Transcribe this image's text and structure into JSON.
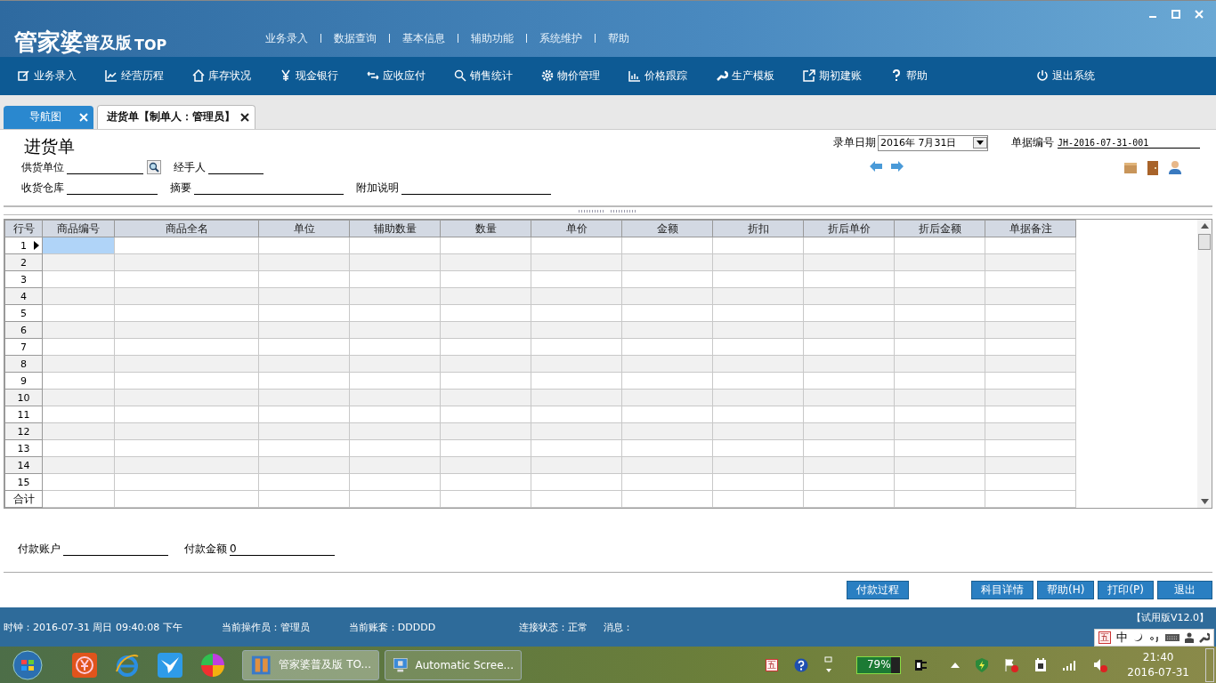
{
  "logo": {
    "name": "管家婆",
    "edition": "普及版",
    "suffix": "TOP"
  },
  "menu": [
    "业务录入",
    "数据查询",
    "基本信息",
    "辅助功能",
    "系统维护",
    "帮助"
  ],
  "toolbar": [
    {
      "label": "业务录入",
      "kind": "entry"
    },
    {
      "label": "经营历程",
      "kind": "chart"
    },
    {
      "label": "库存状况",
      "kind": "home"
    },
    {
      "label": "现金银行",
      "kind": "yen"
    },
    {
      "label": "应收应付",
      "kind": "swap"
    },
    {
      "label": "销售统计",
      "kind": "search"
    },
    {
      "label": "物价管理",
      "kind": "gear"
    },
    {
      "label": "价格跟踪",
      "kind": "bars"
    },
    {
      "label": "生产模板",
      "kind": "wrench"
    },
    {
      "label": "期初建账",
      "kind": "export"
    },
    {
      "label": "帮助",
      "kind": "help"
    },
    {
      "label": "退出系统",
      "kind": "power"
    }
  ],
  "tabs": [
    {
      "label": "导航图",
      "selected": false
    },
    {
      "label": "进货单【制单人：管理员】",
      "selected": true
    }
  ],
  "form": {
    "title": "进货单",
    "date_label": "录单日期",
    "date_value": "2016年 7月31日",
    "number_label": "单据编号",
    "number_value": "JH-2016-07-31-001",
    "row1": [
      {
        "label": "供货单位",
        "kind": "lookup"
      },
      {
        "label": "经手人",
        "kind": "plain"
      }
    ],
    "row2": [
      {
        "label": "收货仓库",
        "kind": "plain"
      },
      {
        "label": "摘要",
        "kind": "wide"
      },
      {
        "label": "附加说明",
        "kind": "wide"
      }
    ]
  },
  "grid": {
    "columns": [
      "行号",
      "商品编号",
      "商品全名",
      "单位",
      "辅助数量",
      "数量",
      "单价",
      "金额",
      "折扣",
      "折后单价",
      "折后金额",
      "单据备注"
    ],
    "rows": [
      {
        "no": "1",
        "selected": true
      },
      {
        "no": "2",
        "selected": false
      },
      {
        "no": "3",
        "selected": false
      },
      {
        "no": "4",
        "selected": false
      },
      {
        "no": "5",
        "selected": false
      },
      {
        "no": "6",
        "selected": false
      },
      {
        "no": "7",
        "selected": false
      },
      {
        "no": "8",
        "selected": false
      },
      {
        "no": "9",
        "selected": false
      },
      {
        "no": "10",
        "selected": false
      },
      {
        "no": "11",
        "selected": false
      },
      {
        "no": "12",
        "selected": false
      },
      {
        "no": "13",
        "selected": false
      },
      {
        "no": "14",
        "selected": false
      },
      {
        "no": "15",
        "selected": false
      }
    ],
    "total_label": "合计"
  },
  "payment": [
    {
      "label": "付款账户"
    },
    {
      "label": "付款金额",
      "value": "0"
    }
  ],
  "buttons": [
    {
      "label": "付款过程",
      "kind": "left"
    },
    {
      "label": "科目详情",
      "kind": "right"
    },
    {
      "label": "帮助(H)",
      "kind": "right"
    },
    {
      "label": "打印(P)",
      "kind": "right"
    },
    {
      "label": "退出",
      "kind": "right"
    }
  ],
  "status": {
    "clock": "时钟：2016-07-31 周日 09:40:08 下午",
    "operator": "当前操作员：管理员",
    "account": "当前账套：DDDDD",
    "connection": "连接状态：正常",
    "message": "消息：",
    "version": "【试用版V12.0】"
  },
  "ime": {
    "mode": "五",
    "lang": "中"
  },
  "taskbar": {
    "windows": [
      {
        "label": "管家婆普及版 TO...",
        "selected": true
      },
      {
        "label": "Automatic Scree...",
        "selected": false
      }
    ],
    "tray_ime": "五",
    "battery": {
      "text": "79%",
      "level": 0.79
    },
    "time": "21:40",
    "date": "2016-07-31"
  }
}
